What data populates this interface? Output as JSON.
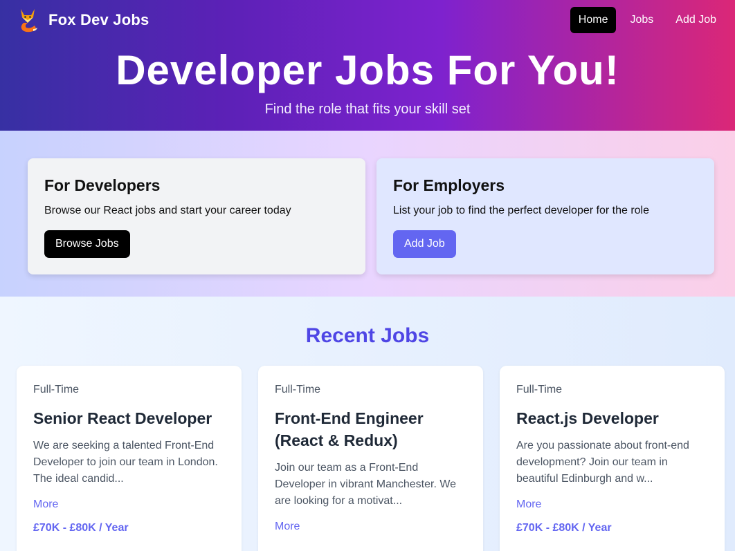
{
  "brand": {
    "name": "Fox Dev Jobs",
    "logo_icon": "fox-logo-icon"
  },
  "nav": {
    "items": [
      {
        "label": "Home",
        "active": true
      },
      {
        "label": "Jobs",
        "active": false
      },
      {
        "label": "Add Job",
        "active": false
      }
    ]
  },
  "hero": {
    "title": "Developer Jobs For You!",
    "subtitle": "Find the role that fits your skill set"
  },
  "developers_card": {
    "title": "For Developers",
    "text": "Browse our React jobs and start your career today",
    "button_label": "Browse Jobs"
  },
  "employers_card": {
    "title": "For Employers",
    "text": "List your job to find the perfect developer for the role",
    "button_label": "Add Job"
  },
  "recent": {
    "title": "Recent Jobs",
    "jobs": [
      {
        "type": "Full-Time",
        "title": "Senior React Developer",
        "description": "We are seeking a talented Front-End Developer to join our team in London. The ideal candid...",
        "more_label": "More",
        "salary": "£70K - £80K / Year"
      },
      {
        "type": "Full-Time",
        "title": "Front-End Engineer (React & Redux)",
        "description": "Join our team as a Front-End Developer in vibrant Manchester. We are looking for a motivat...",
        "more_label": "More",
        "salary": ""
      },
      {
        "type": "Full-Time",
        "title": "React.js Developer",
        "description": "Are you passionate about front-end development? Join our team in beautiful Edinburgh and w...",
        "more_label": "More",
        "salary": "£70K - £80K / Year"
      }
    ]
  },
  "colors": {
    "accent": "#6366f1",
    "heading_accent": "#4f46e5",
    "nav_active_bg": "#000000",
    "hero_gradient_start": "#3730a3",
    "hero_gradient_end": "#db2777"
  }
}
